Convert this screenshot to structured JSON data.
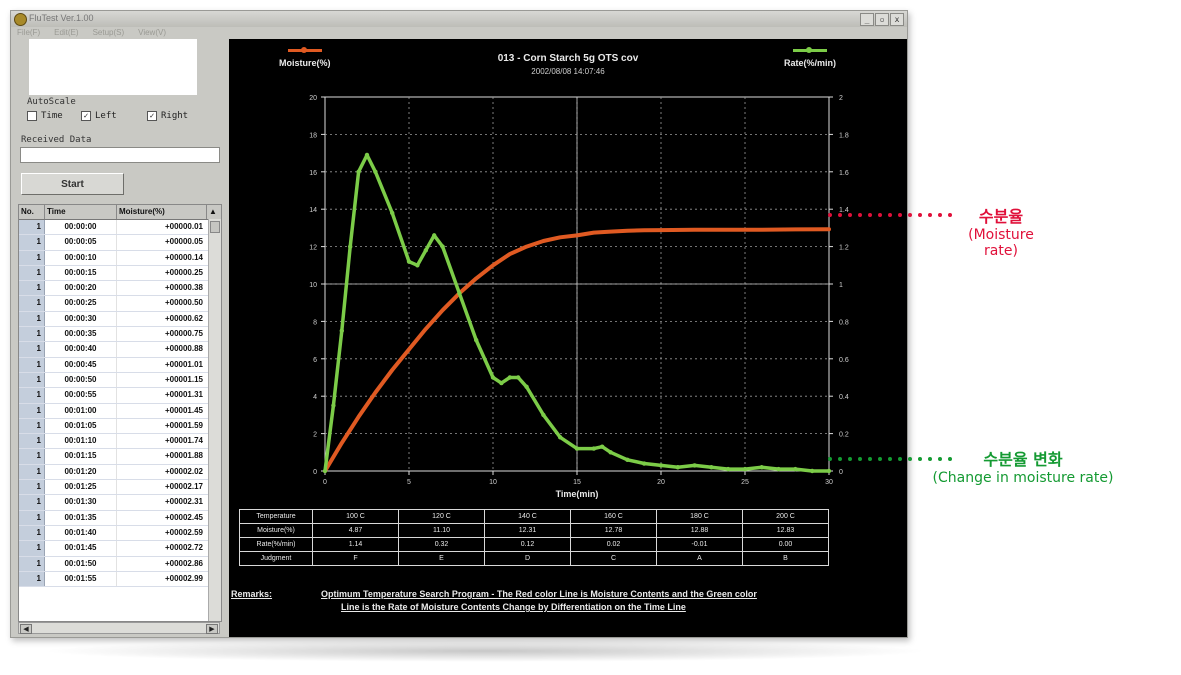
{
  "window": {
    "title": "FluTest Ver.1.00",
    "controls": [
      "_",
      "▫",
      "x"
    ]
  },
  "menu": [
    "File(F)",
    "Edit(E)",
    "Setup(S)",
    "View(V)"
  ],
  "autoscale": {
    "label": "AutoScale",
    "options": [
      {
        "label": "Time",
        "checked": false
      },
      {
        "label": "Left",
        "checked": true
      },
      {
        "label": "Right",
        "checked": true
      }
    ]
  },
  "received": {
    "label": "Received Data",
    "value": ""
  },
  "start_button": "Start",
  "table": {
    "headers": [
      "No.",
      "Time",
      "Moisture(%)"
    ],
    "rows": [
      [
        "1",
        "00:00:00",
        "+00000.01"
      ],
      [
        "1",
        "00:00:05",
        "+00000.05"
      ],
      [
        "1",
        "00:00:10",
        "+00000.14"
      ],
      [
        "1",
        "00:00:15",
        "+00000.25"
      ],
      [
        "1",
        "00:00:20",
        "+00000.38"
      ],
      [
        "1",
        "00:00:25",
        "+00000.50"
      ],
      [
        "1",
        "00:00:30",
        "+00000.62"
      ],
      [
        "1",
        "00:00:35",
        "+00000.75"
      ],
      [
        "1",
        "00:00:40",
        "+00000.88"
      ],
      [
        "1",
        "00:00:45",
        "+00001.01"
      ],
      [
        "1",
        "00:00:50",
        "+00001.15"
      ],
      [
        "1",
        "00:00:55",
        "+00001.31"
      ],
      [
        "1",
        "00:01:00",
        "+00001.45"
      ],
      [
        "1",
        "00:01:05",
        "+00001.59"
      ],
      [
        "1",
        "00:01:10",
        "+00001.74"
      ],
      [
        "1",
        "00:01:15",
        "+00001.88"
      ],
      [
        "1",
        "00:01:20",
        "+00002.02"
      ],
      [
        "1",
        "00:01:25",
        "+00002.17"
      ],
      [
        "1",
        "00:01:30",
        "+00002.31"
      ],
      [
        "1",
        "00:01:35",
        "+00002.45"
      ],
      [
        "1",
        "00:01:40",
        "+00002.59"
      ],
      [
        "1",
        "00:01:45",
        "+00002.72"
      ],
      [
        "1",
        "00:01:50",
        "+00002.86"
      ],
      [
        "1",
        "00:01:55",
        "+00002.99"
      ]
    ]
  },
  "chart_data": {
    "type": "line",
    "title": "013 - Corn Starch 5g OTS cov",
    "subtitle": "2002/08/08 14:07:46",
    "xlabel": "Time(min)",
    "ylabel_left": "Moisture(%)",
    "ylabel_right": "Rate(%/min)",
    "xlim": [
      0,
      30
    ],
    "ylim_left": [
      0,
      20
    ],
    "ylim_right": [
      0,
      2
    ],
    "xticks": [
      0,
      5,
      10,
      15,
      20,
      25,
      30
    ],
    "yticks_left": [
      0,
      2,
      4,
      6,
      8,
      10,
      12,
      14,
      16,
      18,
      20
    ],
    "yticks_right": [
      0,
      0.2,
      0.4,
      0.6,
      0.8,
      1,
      1.2,
      1.4,
      1.6,
      1.8,
      2
    ],
    "grid": true,
    "legend_placement": "top",
    "series": [
      {
        "name": "Moisture(%)",
        "axis": "left",
        "color": "#e05a22",
        "x": [
          0,
          1,
          2,
          3,
          4,
          5,
          6,
          7,
          8,
          9,
          10,
          11,
          12,
          13,
          14,
          15,
          16,
          17,
          18,
          19,
          20,
          22,
          24,
          26,
          28,
          30
        ],
        "y": [
          0,
          1.5,
          2.9,
          4.2,
          5.4,
          6.5,
          7.6,
          8.6,
          9.5,
          10.3,
          11.0,
          11.6,
          12.0,
          12.3,
          12.5,
          12.6,
          12.75,
          12.8,
          12.85,
          12.87,
          12.88,
          12.9,
          12.9,
          12.9,
          12.92,
          12.93
        ]
      },
      {
        "name": "Rate(%/min)",
        "axis": "right",
        "color": "#7ccc48",
        "x": [
          0,
          0.5,
          1,
          1.5,
          2,
          2.5,
          3,
          4,
          5,
          5.5,
          6,
          6.5,
          7,
          8,
          9,
          10,
          10.5,
          11,
          11.5,
          12,
          13,
          14,
          15,
          16,
          16.5,
          17,
          18,
          19,
          20,
          21,
          22,
          23,
          24,
          25,
          26,
          27,
          28,
          29,
          30
        ],
        "y": [
          0,
          0.35,
          0.75,
          1.2,
          1.6,
          1.69,
          1.6,
          1.38,
          1.12,
          1.1,
          1.18,
          1.26,
          1.2,
          0.95,
          0.7,
          0.5,
          0.47,
          0.5,
          0.5,
          0.45,
          0.3,
          0.18,
          0.12,
          0.12,
          0.13,
          0.1,
          0.06,
          0.04,
          0.03,
          0.02,
          0.03,
          0.02,
          0.01,
          0.01,
          0.02,
          0.01,
          0.01,
          0.0,
          0.0
        ]
      }
    ]
  },
  "data_table": {
    "rows": [
      {
        "label": "Temperature",
        "cells": [
          "100 C",
          "120 C",
          "140 C",
          "160 C",
          "180 C",
          "200 C"
        ]
      },
      {
        "label": "Moisture(%)",
        "cells": [
          "4.87",
          "11.10",
          "12.31",
          "12.78",
          "12.88",
          "12.83"
        ]
      },
      {
        "label": "Rate(%/min)",
        "cells": [
          "1.14",
          "0.32",
          "0.12",
          "0.02",
          "-0.01",
          "0.00"
        ]
      },
      {
        "label": "Judgment",
        "cells": [
          "F",
          "E",
          "D",
          "C",
          "A",
          "B"
        ]
      }
    ]
  },
  "remarks": {
    "label": "Remarks:",
    "line1": "Optimum Temperature Search Program - The Red color Line is Moisture Contents and the Green color",
    "line2": "Line is the Rate of Moisture Contents Change by Differentiation on the Time Line"
  },
  "annotations": [
    {
      "kr": "수분율",
      "en": "(Moisture rate)",
      "color": "#e0103a"
    },
    {
      "kr": "수분율 변화",
      "en": "(Change in moisture rate)",
      "color": "#149a32"
    }
  ]
}
